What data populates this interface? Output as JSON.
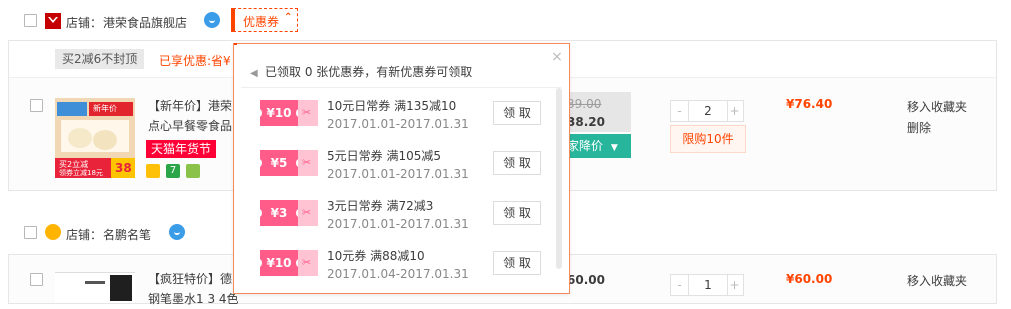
{
  "stores": [
    {
      "name_label": "店铺：",
      "name": "港荣食品旗舰店",
      "coupon_button": "优惠券",
      "promo_tag": "买2减6不封顶",
      "promo_saved": "已享优惠:省¥",
      "product": {
        "title_line1": "【新年价】港荣",
        "title_line2": "点心早餐零食品",
        "tmall_tag": "天猫年货节",
        "image_top_text": "新年价",
        "image_mid_text": "买2立减",
        "image_bottom_text": "领券立减18元",
        "image_price": "38",
        "old_price": "39.00",
        "new_price": "38.20",
        "price_button": "家降价",
        "quantity": "2",
        "qty_minus": "-",
        "qty_plus": "+",
        "limit": "限购10件",
        "subtotal": "¥76.40",
        "op_fav": "移入收藏夹",
        "op_delete": "删除"
      }
    },
    {
      "name_label": "店铺：",
      "name": "名鹏名笔",
      "product": {
        "title_line1": "【疯狂特价】德",
        "title_line2": "钢笔墨水1 3 4色",
        "new_price": "60.00",
        "quantity": "1",
        "qty_minus": "-",
        "qty_plus": "+",
        "subtotal": "¥60.00",
        "op_fav": "移入收藏夹"
      }
    }
  ],
  "coupon_popup": {
    "notice": "已领取 0 张优惠券，有新优惠券可领取",
    "close": "×",
    "coupons": [
      {
        "amount": "¥10",
        "title": "10元日常券 满135减10",
        "dates": "2017.01.01-2017.01.31",
        "button": "领 取"
      },
      {
        "amount": "¥5",
        "title": "5元日常券 满105减5",
        "dates": "2017.01.01-2017.01.31",
        "button": "领 取"
      },
      {
        "amount": "¥3",
        "title": "3元日常券 满72减3",
        "dates": "2017.01.01-2017.01.31",
        "button": "领 取"
      },
      {
        "amount": "¥10",
        "title": "10元券 满88减10",
        "dates": "2017.01.04-2017.01.31",
        "button": "领 取"
      }
    ]
  },
  "colors": {
    "accent": "#ff4400",
    "tmall_red": "#ff0036",
    "coupon_pink": "#ff5c8a",
    "green": "#27b69c"
  }
}
